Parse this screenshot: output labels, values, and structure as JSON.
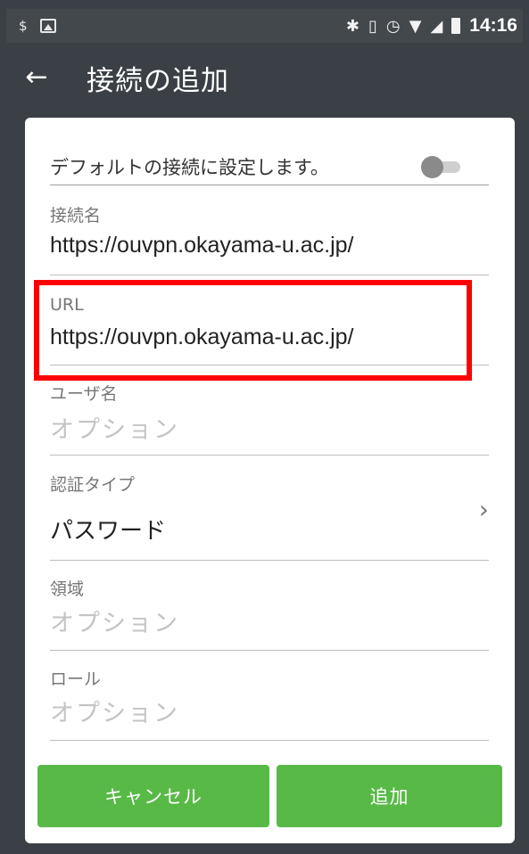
{
  "status_bar": {
    "time": "14:16",
    "icons": [
      "dollar-icon",
      "image-icon",
      "bluetooth-icon",
      "vibrate-icon",
      "alarm-icon",
      "wifi-icon",
      "signal-icon",
      "battery-icon"
    ]
  },
  "app_bar": {
    "title": "接続の追加",
    "back_icon": "arrow-left-icon"
  },
  "form": {
    "default_label": "デフォルトの接続に設定します。",
    "default_enabled": false,
    "connection_name": {
      "label": "接続名",
      "value": "https://ouvpn.okayama-u.ac.jp/"
    },
    "url": {
      "label": "URL",
      "value": "https://ouvpn.okayama-u.ac.jp/"
    },
    "username": {
      "label": "ユーザ名",
      "placeholder": "オプション"
    },
    "auth_type": {
      "label": "認証タイプ",
      "value": "パスワード"
    },
    "realm": {
      "label": "領域",
      "placeholder": "オプション"
    },
    "role": {
      "label": "ロール",
      "placeholder": "オプション"
    }
  },
  "buttons": {
    "cancel": "キャンセル",
    "add": "追加"
  },
  "colors": {
    "app_bar": "#3a4045",
    "button": "#58b947",
    "highlight": "#ff0000"
  }
}
